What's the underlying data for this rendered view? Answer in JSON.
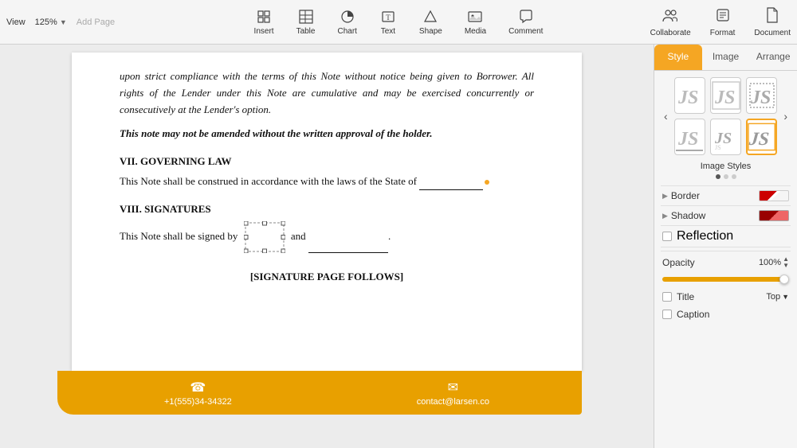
{
  "toolbar": {
    "view_label": "View",
    "zoom_label": "125%",
    "add_page_label": "Add Page",
    "items": [
      {
        "label": "Insert",
        "icon": "insert-icon"
      },
      {
        "label": "Table",
        "icon": "table-icon"
      },
      {
        "label": "Chart",
        "icon": "chart-icon"
      },
      {
        "label": "Text",
        "icon": "text-icon"
      },
      {
        "label": "Shape",
        "icon": "shape-icon"
      },
      {
        "label": "Media",
        "icon": "media-icon"
      },
      {
        "label": "Comment",
        "icon": "comment-icon"
      }
    ],
    "right_items": [
      {
        "label": "Collaborate",
        "icon": "collaborate-icon"
      },
      {
        "label": "Format",
        "icon": "format-icon"
      },
      {
        "label": "Document",
        "icon": "document-icon"
      }
    ]
  },
  "document": {
    "body_text": "upon strict compliance with the terms of this Note without notice being given to Borrower. All rights of the Lender under this Note are cumulative and may be exercised concurrently or consecutively at the Lender's option.",
    "bold_text": "This note may not be amended without the written approval of the holder.",
    "section7_heading": "VII. GOVERNING LAW",
    "section7_body": "This Note shall be construed in accordance with the laws of the State of",
    "section8_heading": "VIII. SIGNATURES",
    "section8_body_pre": "This Note shall be signed by",
    "section8_body_mid": "and",
    "signature_follows": "[SIGNATURE PAGE FOLLOWS]"
  },
  "footer": {
    "phone_icon": "phone-icon",
    "phone_number": "+1(555)34-34322",
    "email_icon": "email-icon",
    "email_address": "contact@larsen.co"
  },
  "right_panel": {
    "tabs": [
      {
        "label": "Style",
        "active": true
      },
      {
        "label": "Image",
        "active": false
      },
      {
        "label": "Arrange",
        "active": false
      }
    ],
    "image_styles_label": "Image Styles",
    "border_label": "Border",
    "shadow_label": "Shadow",
    "reflection_label": "Reflection",
    "opacity_label": "Opacity",
    "opacity_value": "100%",
    "title_label": "Title",
    "title_position": "Top",
    "caption_label": "Caption"
  }
}
